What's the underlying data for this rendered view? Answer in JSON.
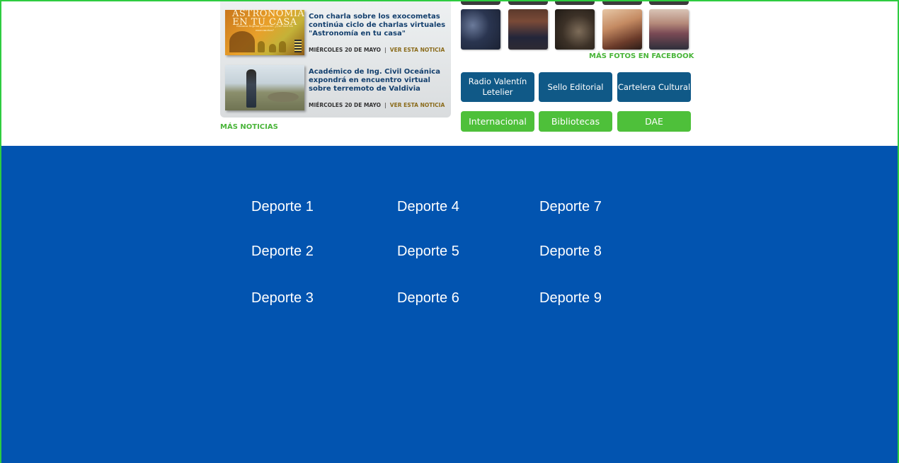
{
  "news": {
    "items": [
      {
        "title": "Con charla sobre los exocometas continúa ciclo de charlas virtuales \"Astronomía en tu casa\"",
        "date": "MIÉRCOLES 20 DE MAYO",
        "separator": "|",
        "link": "VER ESTA NOTICIA",
        "thumb_title": "ASTRONOMÍA EN TU CASA",
        "thumb_caption": "Semana Sopena presenta: ¿Qué son los exocometas?"
      },
      {
        "title": "Académico de Ing. Civil Oceánica expondrá en encuentro virtual sobre terremoto de Valdivia",
        "date": "MIÉRCOLES 20 DE MAYO",
        "separator": "|",
        "link": "VER ESTA NOTICIA"
      }
    ],
    "more_label": "MÁS NOTICIAS"
  },
  "photos": {
    "more_label": "MÁS FOTOS EN FACEBOOK"
  },
  "links": {
    "blue": [
      "Radio Valentín Letelier",
      "Sello Editorial",
      "Cartelera Cultural"
    ],
    "green": [
      "Internacional",
      "Bibliotecas",
      "DAE"
    ]
  },
  "sports": {
    "col1": [
      "Deporte 1",
      "Deporte 2",
      "Deporte 3"
    ],
    "col2": [
      "Deporte 4",
      "Deporte 5",
      "Deporte 6"
    ],
    "col3": [
      "Deporte 7",
      "Deporte 8",
      "Deporte 9"
    ]
  },
  "colors": {
    "footer_blue": "#0254b0",
    "link_blue": "#105987",
    "link_green": "#4ec03a",
    "accent_green": "#4ab53a",
    "news_title": "#14406e"
  }
}
